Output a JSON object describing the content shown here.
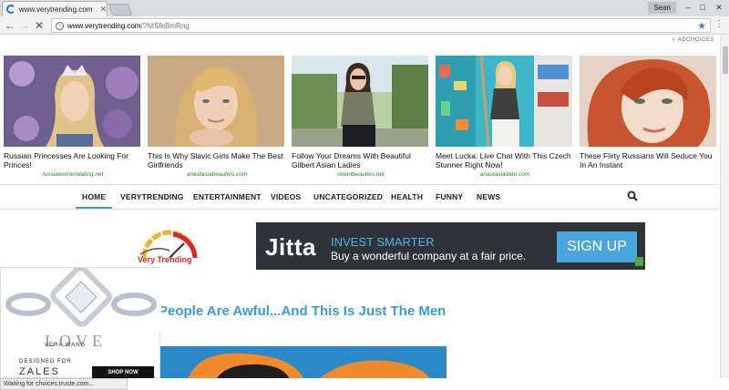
{
  "browser": {
    "tab_title": "www.verytrending.com",
    "user": "Sean",
    "url_host": "www.verytrending.com",
    "url_path": "/?NtSfeBmRng",
    "status": "Waiting for choices.truste.com..."
  },
  "adchoices_label": "ADCHOICES",
  "ads": [
    {
      "title": "Russian Princesses Are Looking For Princes!",
      "source": "russiawomendating.net"
    },
    {
      "title": "This Is Why Slavic Girls Make The Best Girlfriends",
      "source": "anastasiabeauties.com"
    },
    {
      "title": "Follow Your Dreams With Beautiful Gilbert Asian Ladies",
      "source": "orientbeauties.net"
    },
    {
      "title": "Meet Lucka: Live Chat With This Czech Stunner Right Now!",
      "source": "anastasiadate.com"
    },
    {
      "title": "These Flirty Russians Will Seduce You In An Instant",
      "source": ""
    }
  ],
  "nav": [
    "HOME",
    "VERYTRENDING",
    "ENTERTAINMENT",
    "VIDEOS",
    "UNCATEGORIZED",
    "HEALTH",
    "FUNNY",
    "NEWS"
  ],
  "site_logo_text": "Very Trending",
  "banner": {
    "brand": "Jitta",
    "headline": "INVEST SMARTER",
    "subline": "Buy a wonderful company at a fair price.",
    "cta": "SIGN UP"
  },
  "article": {
    "headline": "People Are Awful...And This Is Just The Men"
  },
  "side_ad": {
    "brand": "LOVE",
    "designer": "VERA WANG",
    "designed_for": "DESIGNED FOR",
    "store": "ZALES",
    "cta": "SHOP NOW"
  },
  "colors": {
    "accent": "#3c9bd6",
    "logo_red": "#d62828",
    "source_green": "#2e7d32"
  }
}
